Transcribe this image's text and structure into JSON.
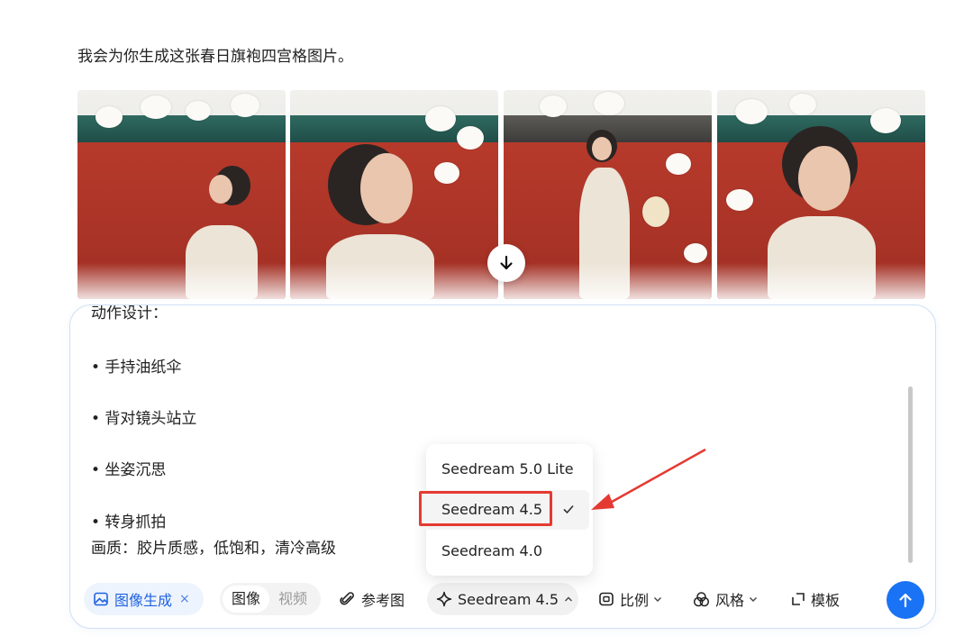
{
  "intro_text": "我会为你生成这张春日旗袍四宫格图片。",
  "prompt": {
    "partial_line": "动作设计：",
    "lines": [
      "• 手持油纸伞",
      "• 背对镜头站立",
      "• 坐姿沉思",
      "• 转身抓拍",
      "画质：胶片质感，低饱和，清冷高级"
    ]
  },
  "toolbar": {
    "image_gen_label": "图像生成",
    "close_symbol": "×",
    "mode_image": "图像",
    "mode_video": "视频",
    "reference_label": "参考图",
    "model_label": "Seedream 4.5",
    "ratio_label": "比例",
    "style_label": "风格",
    "template_label": "模板"
  },
  "model_menu": {
    "options": [
      "Seedream 5.0 Lite",
      "Seedream 4.5",
      "Seedream 4.0"
    ],
    "selected": "Seedream 4.5"
  },
  "colors": {
    "accent": "#1a73f5",
    "highlight": "#e53a32"
  }
}
